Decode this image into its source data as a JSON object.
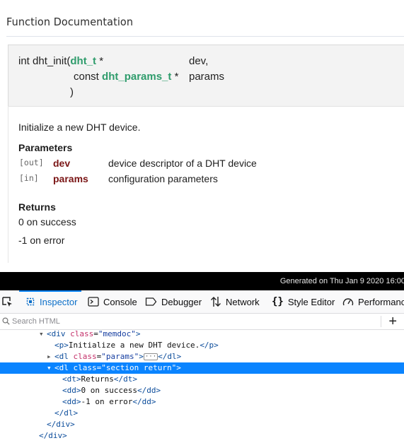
{
  "page": {
    "section_title": "Function Documentation",
    "proto": {
      "ret_and_name": "int dht_init(",
      "type1": "dht_t",
      "star1": " *",
      "param1": "dev,",
      "const": "const",
      "type2": "dht_params_t",
      "star2": " *",
      "param2": "params",
      "close": ")"
    },
    "description": "Initialize a new DHT device.",
    "parameters_heading": "Parameters",
    "params": [
      {
        "dir": "[out]",
        "name": "dev",
        "desc": "device descriptor of a DHT device"
      },
      {
        "dir": "[in]",
        "name": "params",
        "desc": "configuration parameters"
      }
    ],
    "returns_heading": "Returns",
    "returns": [
      "0 on success",
      "-1 on error"
    ],
    "footer": "Generated on Thu Jan 9 2020 16:00"
  },
  "devtools": {
    "tabs": {
      "inspector": "Inspector",
      "console": "Console",
      "debugger": "Debugger",
      "network": "Network",
      "style_editor": "Style Editor",
      "performance": "Performanc"
    },
    "search_placeholder": "Search HTML",
    "add_button": "+",
    "tree": {
      "l1_tag": "div",
      "l1_attr": "class",
      "l1_val": "\"memdoc\"",
      "l2_text": "Initialize a new DHT device.",
      "l3_tag": "dl",
      "l3_attr": "class",
      "l3_val": "\"params\"",
      "l4_tag": "dl",
      "l4_attr": "class",
      "l4_val": "\"section return\"",
      "l5_text": "Returns",
      "l6_text": "0 on success",
      "l7_text": "-1 on error"
    },
    "accent_color": "#0a84ff"
  }
}
